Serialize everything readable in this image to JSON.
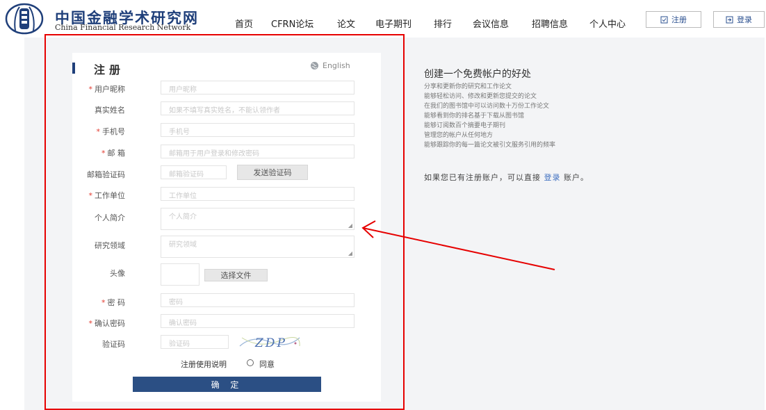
{
  "header": {
    "brand_cn": "中国金融学术研究网",
    "brand_en": "China Financial Research Network",
    "nav": [
      "首页",
      "CFRN论坛",
      "论文",
      "电子期刊",
      "排行",
      "会议信息",
      "招聘信息",
      "个人中心"
    ],
    "register_label": "注册",
    "login_label": "登录",
    "register_icon": "register-icon",
    "login_icon": "login-icon"
  },
  "form": {
    "title": "注册",
    "language_label": "English",
    "language_icon": "globe-icon",
    "fields": {
      "nickname": {
        "label": "用户昵称",
        "required": true,
        "placeholder": "用户昵称"
      },
      "realname": {
        "label": "真实姓名",
        "required": false,
        "placeholder": "如果不填写真实姓名，不能认领作者"
      },
      "phone": {
        "label": "手机号",
        "required": true,
        "placeholder": "手机号"
      },
      "email": {
        "label": "邮 箱",
        "required": true,
        "placeholder": "邮箱用于用户登录和修改密码"
      },
      "email_code": {
        "label": "邮箱验证码",
        "required": false,
        "placeholder": "邮箱验证码",
        "button": "发送验证码"
      },
      "workplace": {
        "label": "工作单位",
        "required": true,
        "placeholder": "工作单位"
      },
      "bio": {
        "label": "个人简介",
        "required": false,
        "placeholder": "个人简介"
      },
      "research": {
        "label": "研究领域",
        "required": false,
        "placeholder": "研究领域"
      },
      "avatar": {
        "label": "头像",
        "button": "选择文件"
      },
      "password": {
        "label": "密 码",
        "required": true,
        "placeholder": "密码"
      },
      "confirm": {
        "label": "确认密码",
        "required": true,
        "placeholder": "确认密码"
      },
      "captcha": {
        "label": "验证码",
        "required": false,
        "placeholder": "验证码",
        "image_text": "ZDP"
      }
    },
    "agreement_label": "注册使用说明",
    "agree_label": "同意",
    "submit_label": "确 定",
    "required_mark": "*"
  },
  "benefits": {
    "title": "创建一个免费帐户的好处",
    "items": [
      "分享和更新你的研究和工作论文",
      "能够轻松访问、修改和更新您提交的论文",
      "在我们的图书馆中可以访问数十万份工作论文",
      "能够看到你的排名基于下载从图书馆",
      "能够订阅数百个摘要电子期刊",
      "管理您的帐户从任何地方",
      "能够跟踪你的每一篇论文被引文服务引用的频率"
    ],
    "login_prefix": "如果您已有注册账户，可以直接",
    "login_link": "登录",
    "login_suffix": "账户。"
  },
  "colors": {
    "brand": "#1f3f7a",
    "submit": "#2b4f84",
    "highlight": "#e60000",
    "link": "#3f6fc0",
    "required": "#e23a2f"
  }
}
